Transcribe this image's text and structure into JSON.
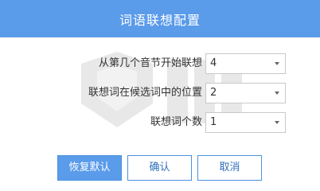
{
  "dialog": {
    "title": "词语联想配置"
  },
  "form": {
    "rows": [
      {
        "label": "从第几个音节开始联想",
        "value": "4"
      },
      {
        "label": "联想词在候选词中的位置",
        "value": "2"
      },
      {
        "label": "联想词个数",
        "value": "1"
      }
    ]
  },
  "buttons": {
    "restore_label": "恢复默认",
    "confirm_label": "确认",
    "cancel_label": "取消"
  },
  "colors": {
    "title_bar": "#5a9bea",
    "primary_button": "#5a9bea",
    "button_border": "#4a90e2",
    "button_text": "#2f6fbe"
  },
  "icons": {
    "dropdown": "chevron-down-icon",
    "watermark": "watermark-logo-icon"
  }
}
